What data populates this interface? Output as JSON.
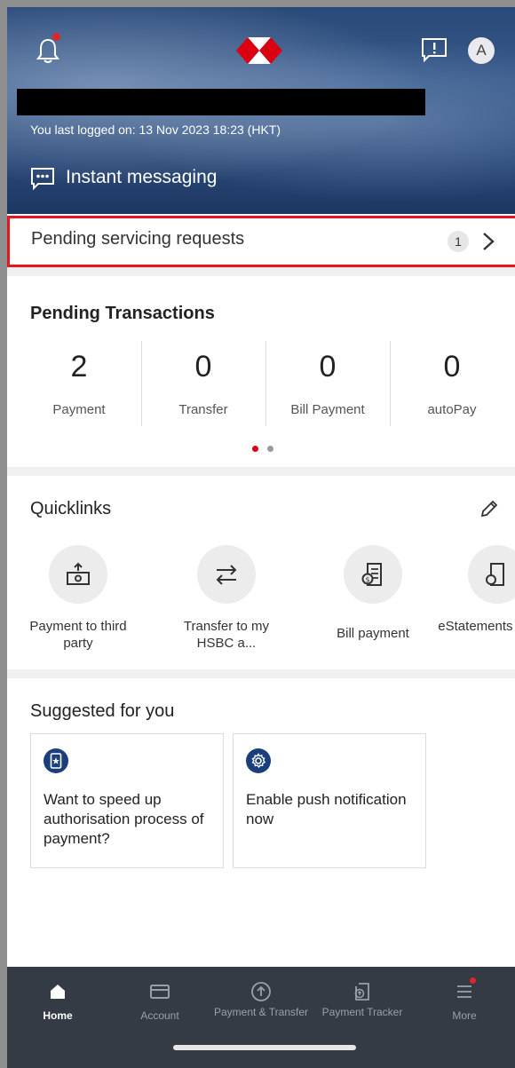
{
  "header": {
    "avatar_initial": "A",
    "last_login": "You last logged on: 13 Nov 2023 18:23 (HKT)",
    "instant_messaging": "Instant messaging",
    "brand_color": "#db0011"
  },
  "servicing": {
    "label": "Pending servicing requests",
    "count": "1"
  },
  "pending_transactions": {
    "title": "Pending Transactions",
    "items": [
      {
        "value": "2",
        "label": "Payment"
      },
      {
        "value": "0",
        "label": "Transfer"
      },
      {
        "value": "0",
        "label": "Bill Payment"
      },
      {
        "value": "0",
        "label": "autoPay"
      }
    ],
    "pager": {
      "pages": 2,
      "current": 1
    }
  },
  "quicklinks": {
    "title": "Quicklinks",
    "items": [
      {
        "label": "Payment to third party",
        "icon": "payment-icon"
      },
      {
        "label": "Transfer to my HSBC a...",
        "icon": "transfer-icon"
      },
      {
        "label": "Bill payment",
        "icon": "bill-icon"
      },
      {
        "label": "eStatements & eA...",
        "icon": "estatement-icon"
      }
    ]
  },
  "suggested": {
    "title": "Suggested for you",
    "cards": [
      {
        "text": "Want to speed up authorisation process of payment?",
        "icon": "mobile-star-icon"
      },
      {
        "text": "Enable push notification now",
        "icon": "gear-icon"
      }
    ]
  },
  "bottom_nav": {
    "items": [
      {
        "label": "Home",
        "active": true
      },
      {
        "label": "Account"
      },
      {
        "label": "Payment & Transfer"
      },
      {
        "label": "Payment Tracker"
      },
      {
        "label": "More"
      }
    ]
  }
}
